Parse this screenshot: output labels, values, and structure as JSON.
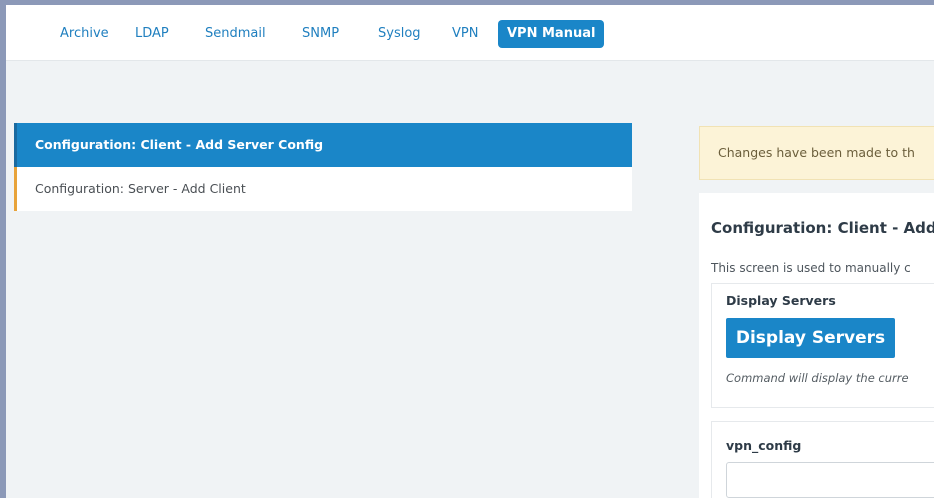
{
  "tabs": [
    {
      "label": "Archive",
      "active": false
    },
    {
      "label": "LDAP",
      "active": false
    },
    {
      "label": "Sendmail",
      "active": false
    },
    {
      "label": "SNMP",
      "active": false
    },
    {
      "label": "Syslog",
      "active": false
    },
    {
      "label": "VPN",
      "active": false
    },
    {
      "label": "VPN Manual",
      "active": true
    }
  ],
  "sidebar": {
    "items": [
      {
        "label": "Configuration: Client - Add Server Config",
        "active": true
      },
      {
        "label": "Configuration: Server - Add Client",
        "active": false
      }
    ]
  },
  "alert": {
    "text": "Changes have been made to th"
  },
  "panel": {
    "title": "Configuration: Client - Add",
    "description": "This screen is used to manually c",
    "display_servers": {
      "label": "Display Servers",
      "button_label": "Display Servers",
      "note": "Command will display the curre"
    },
    "vpn_config": {
      "label": "vpn_config",
      "value": ""
    }
  },
  "colors": {
    "accent": "#1a86c8",
    "alert_bg": "#fcf3d7",
    "nav_border": "#e8a33a"
  }
}
